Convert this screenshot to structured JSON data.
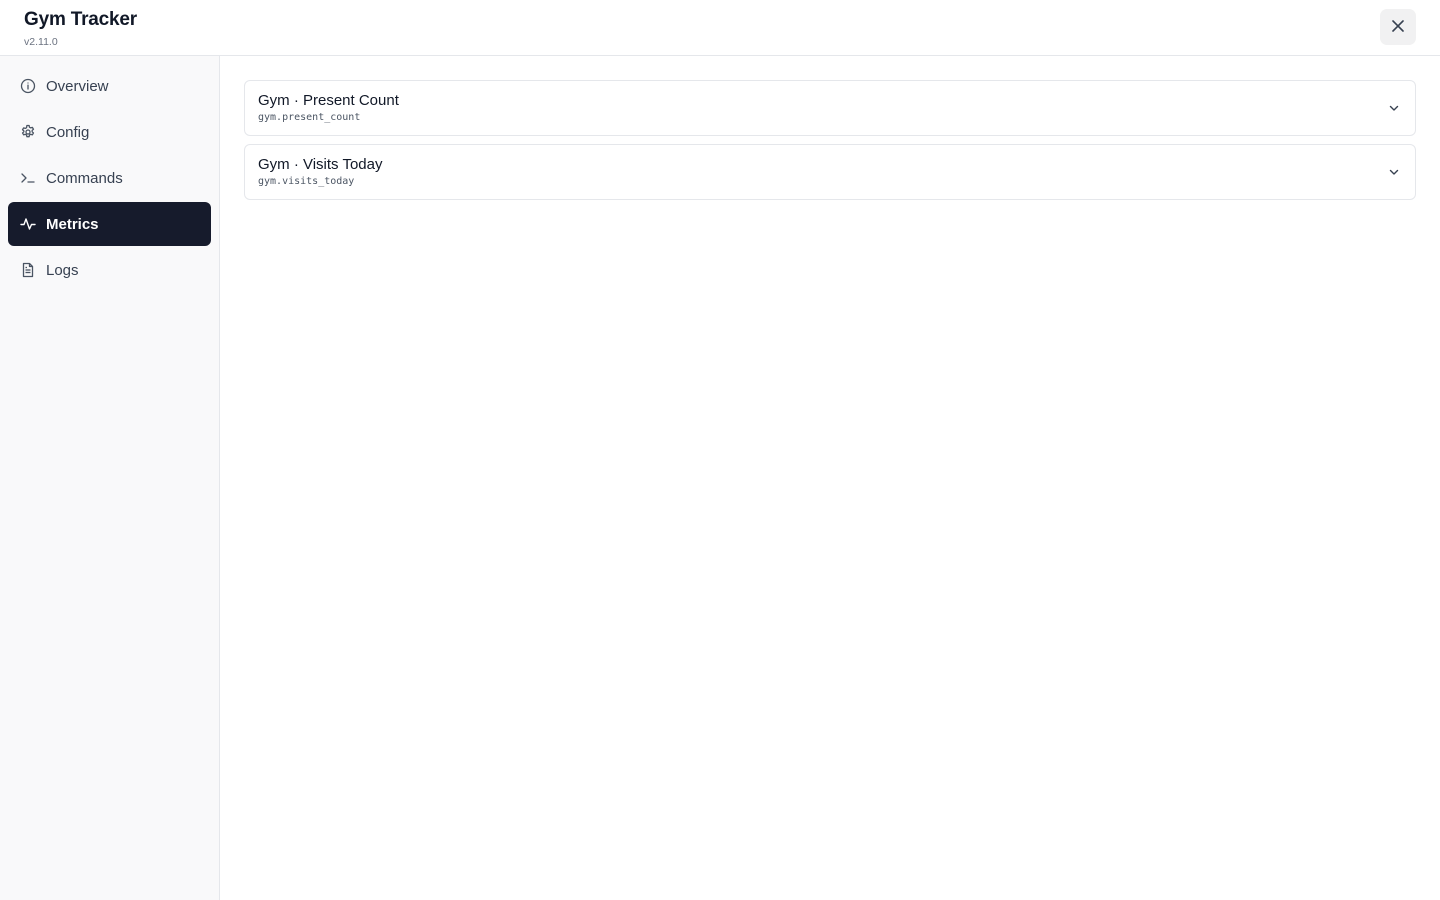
{
  "app": {
    "title": "Gym Tracker",
    "version": "v2.11.0",
    "close_icon": "close-icon"
  },
  "sidebar": {
    "items": [
      {
        "label": "Overview",
        "icon": "info-icon",
        "active": false
      },
      {
        "label": "Config",
        "icon": "gear-icon",
        "active": false
      },
      {
        "label": "Commands",
        "icon": "terminal-icon",
        "active": false
      },
      {
        "label": "Metrics",
        "icon": "activity-icon",
        "active": true
      },
      {
        "label": "Logs",
        "icon": "file-icon",
        "active": false
      }
    ]
  },
  "metrics": [
    {
      "title": "Gym · Present Count",
      "key": "gym.present_count",
      "expanded": false
    },
    {
      "title": "Gym · Visits Today",
      "key": "gym.visits_today",
      "expanded": false
    }
  ],
  "colors": {
    "active_nav_bg": "#161b2c",
    "sidebar_bg": "#f9f9fa",
    "border": "#e5e7eb"
  }
}
